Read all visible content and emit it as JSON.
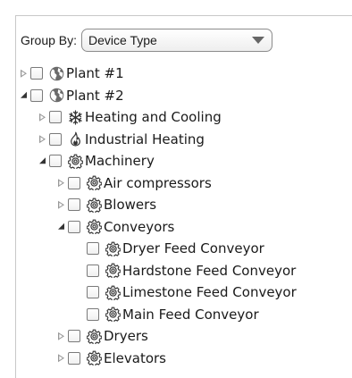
{
  "toolbar": {
    "group_by_label": "Group By:",
    "group_by_value": "Device Type"
  },
  "tree": [
    {
      "label": "Plant #1",
      "icon": "globe-icon",
      "level": 0,
      "state": "collapsed"
    },
    {
      "label": "Plant #2",
      "icon": "globe-icon",
      "level": 0,
      "state": "expanded"
    },
    {
      "label": "Heating and Cooling",
      "icon": "snowflake-icon",
      "level": 1,
      "state": "collapsed"
    },
    {
      "label": "Industrial Heating",
      "icon": "flame-icon",
      "level": 1,
      "state": "collapsed"
    },
    {
      "label": "Machinery",
      "icon": "gear-icon",
      "level": 1,
      "state": "expanded"
    },
    {
      "label": "Air compressors",
      "icon": "gear-icon",
      "level": 2,
      "state": "collapsed"
    },
    {
      "label": "Blowers",
      "icon": "gear-icon",
      "level": 2,
      "state": "collapsed"
    },
    {
      "label": "Conveyors",
      "icon": "gear-icon",
      "level": 2,
      "state": "expanded"
    },
    {
      "label": "Dryer Feed Conveyor",
      "icon": "gear-icon",
      "level": 3,
      "state": "leaf"
    },
    {
      "label": "Hardstone Feed Conveyor",
      "icon": "gear-icon",
      "level": 3,
      "state": "leaf"
    },
    {
      "label": "Limestone Feed Conveyor",
      "icon": "gear-icon",
      "level": 3,
      "state": "leaf"
    },
    {
      "label": "Main Feed Conveyor",
      "icon": "gear-icon",
      "level": 3,
      "state": "leaf"
    },
    {
      "label": "Dryers",
      "icon": "gear-icon",
      "level": 2,
      "state": "collapsed"
    },
    {
      "label": "Elevators",
      "icon": "gear-icon",
      "level": 2,
      "state": "collapsed"
    }
  ]
}
